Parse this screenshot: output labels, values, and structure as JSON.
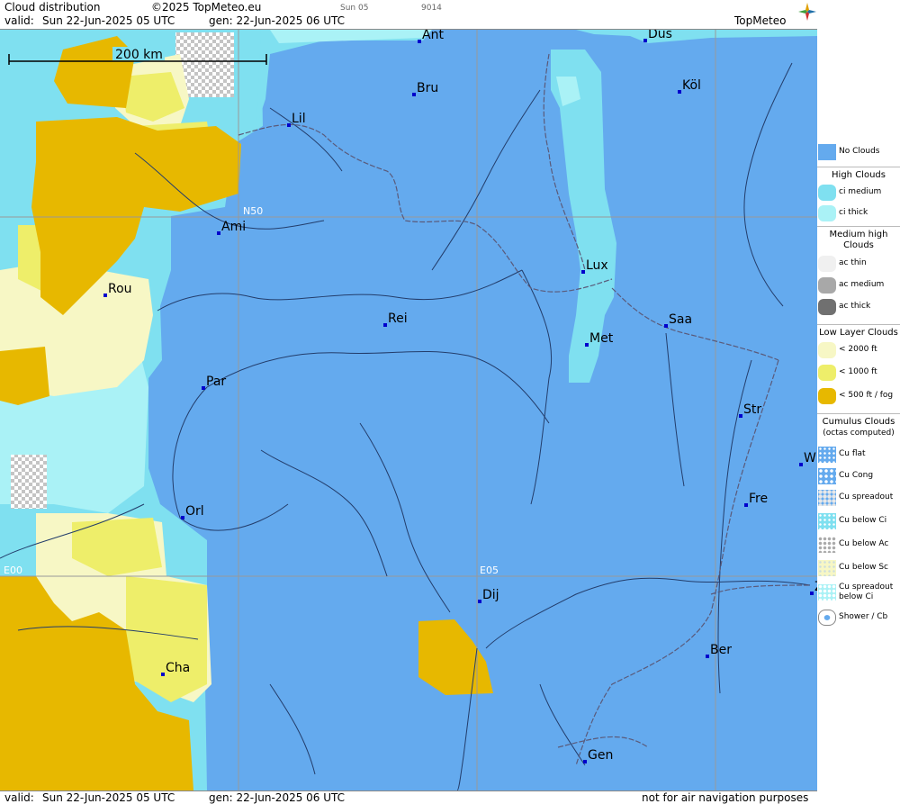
{
  "header": {
    "title": "Cloud distribution",
    "copyright": "©2025 TopMeteo.eu",
    "run": "Sun 05",
    "code": "9014",
    "valid_label": "valid:",
    "valid_date": "Sun   22-Jun-2025   05 UTC",
    "gen": "gen:  22-Jun-2025 06 UTC",
    "logo": "TopMeteo"
  },
  "footer": {
    "valid_label": "valid:",
    "valid_date": "Sun   22-Jun-2025   05 UTC",
    "gen": "gen:  22-Jun-2025 06 UTC",
    "disclaimer": "not for air navigation purposes"
  },
  "map": {
    "scale": "200 km",
    "grid_labels": {
      "n50": "N50",
      "e00": "E00",
      "e05": "E05"
    },
    "cities": [
      {
        "name": "Ant"
      },
      {
        "name": "Düs"
      },
      {
        "name": "Bru"
      },
      {
        "name": "Köl"
      },
      {
        "name": "Lil"
      },
      {
        "name": "Ami"
      },
      {
        "name": "Lux"
      },
      {
        "name": "Rou"
      },
      {
        "name": "Rei"
      },
      {
        "name": "Saa"
      },
      {
        "name": "Met"
      },
      {
        "name": "Par"
      },
      {
        "name": "Str"
      },
      {
        "name": "W"
      },
      {
        "name": "Fre"
      },
      {
        "name": "Orl"
      },
      {
        "name": "Dij"
      },
      {
        "name": "Ber"
      },
      {
        "name": "Cha"
      },
      {
        "name": "Gen"
      },
      {
        "name": "Z"
      }
    ]
  },
  "legend": {
    "no_clouds": "No Clouds",
    "high_head": "High Clouds",
    "ci_medium": "ci medium",
    "ci_thick": "ci thick",
    "medium_head": "Medium high Clouds",
    "ac_thin": "ac thin",
    "ac_medium": "ac medium",
    "ac_thick": "ac thick",
    "low_head": "Low Layer Clouds",
    "low_2000": "< 2000 ft",
    "low_1000": "< 1000 ft",
    "low_500": "< 500 ft / fog",
    "cu_head": "Cumulus Clouds",
    "cu_sub": "(octas computed)",
    "cu_flat": "Cu flat",
    "cu_cong": "Cu Cong",
    "cu_spread": "Cu spreadout",
    "cu_below_ci": "Cu below Ci",
    "cu_below_ac": "Cu below Ac",
    "cu_below_sc": "Cu below Sc",
    "cu_spread_ci": "Cu spreadout below Ci",
    "shower": "Shower / Cb"
  },
  "colors": {
    "no_clouds": "#64aaee",
    "ci_medium": "#7fe0f0",
    "ci_thick": "#aaf2f6",
    "low_2000": "#f7f7c5",
    "low_1000": "#eeee6a",
    "low_500": "#e7b800",
    "ac": "#bdbdbd",
    "river": "#233d6b",
    "border": "#5a5a7a",
    "city": "#0000cc"
  }
}
